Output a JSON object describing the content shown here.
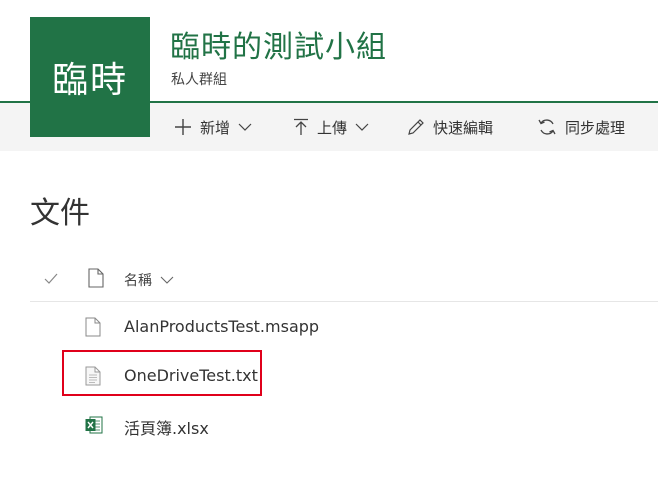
{
  "site": {
    "logo_text": "臨時",
    "title": "臨時的測試小組",
    "subtitle": "私人群組"
  },
  "command_bar": {
    "new_label": "新增",
    "upload_label": "上傳",
    "quick_edit_label": "快速編輯",
    "sync_label": "同步處理"
  },
  "library": {
    "heading": "文件",
    "name_column_label": "名稱",
    "files": [
      {
        "name": "AlanProductsTest.msapp",
        "icon": "generic-file-icon"
      },
      {
        "name": "OneDriveTest.txt",
        "icon": "text-file-icon"
      },
      {
        "name": "活頁簿.xlsx",
        "icon": "excel-file-icon"
      }
    ]
  },
  "colors": {
    "brand": "#217346",
    "command_bar_bg": "#f4f4f4",
    "highlight": "#e0001b"
  },
  "highlighted_file": "OneDriveTest.txt"
}
